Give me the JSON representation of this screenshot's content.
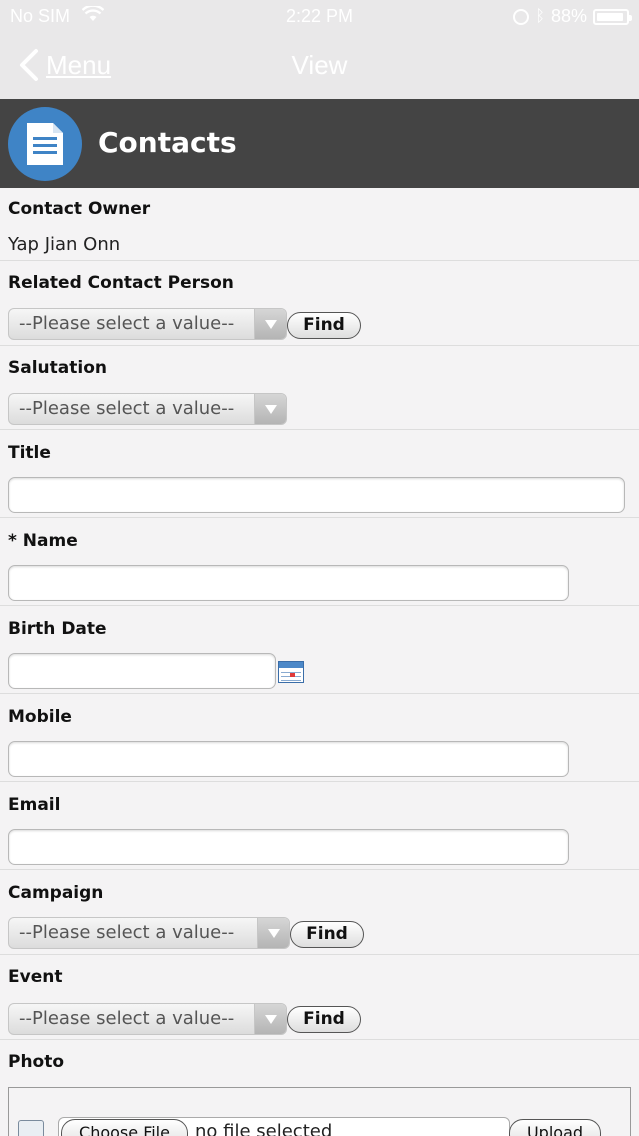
{
  "status_bar": {
    "carrier": "No SIM",
    "time": "2:22 PM",
    "battery": "88%",
    "battery_level": 0.88
  },
  "nav": {
    "back_label": "Menu",
    "title": "View"
  },
  "header": {
    "title": "Contacts",
    "icon": "document-icon"
  },
  "form": {
    "contact_owner": {
      "label": "Contact Owner",
      "value": "Yap Jian Onn"
    },
    "related_contact": {
      "label": "Related Contact Person",
      "select_value": "--Please select a value--",
      "find_label": "Find"
    },
    "salutation": {
      "label": "Salutation",
      "select_value": "--Please select a value--"
    },
    "title": {
      "label": "Title",
      "value": ""
    },
    "name": {
      "label": "* Name",
      "value": ""
    },
    "birth_date": {
      "label": "Birth Date",
      "value": ""
    },
    "mobile": {
      "label": "Mobile",
      "value": ""
    },
    "email": {
      "label": "Email",
      "value": ""
    },
    "campaign": {
      "label": "Campaign",
      "select_value": "--Please select a value--",
      "find_label": "Find"
    },
    "event": {
      "label": "Event",
      "select_value": "--Please select a value--",
      "find_label": "Find"
    },
    "photo": {
      "label": "Photo",
      "choose_label": "Choose File",
      "no_file_text": "no file selected",
      "upload_label": "Upload"
    }
  },
  "colors": {
    "header_bg": "#444444",
    "logo_bg": "#3f84c6",
    "topbar_bg": "#e9e8e9",
    "page_bg": "#f4f3f4"
  }
}
